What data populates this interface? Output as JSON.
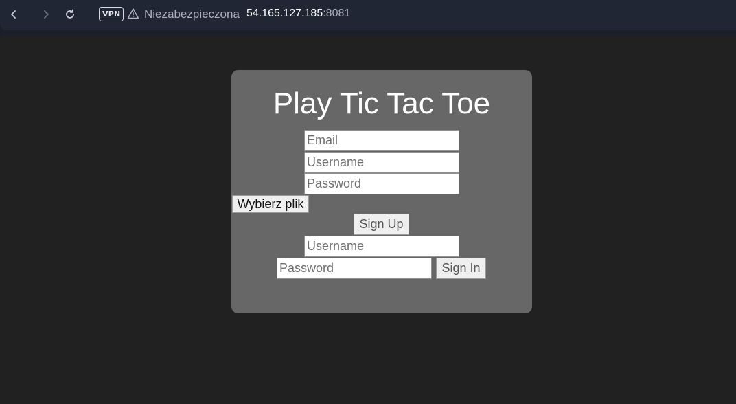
{
  "browser": {
    "vpn_label": "VPN",
    "security_label": "Niezabezpieczona",
    "url_host": "54.165.127.185",
    "url_port": ":8081"
  },
  "page": {
    "title": "Play Tic Tac Toe",
    "signup": {
      "email_placeholder": "Email",
      "username_placeholder": "Username",
      "password_placeholder": "Password",
      "file_button_label": "Wybierz plik",
      "submit_label": "Sign Up"
    },
    "signin": {
      "username_placeholder": "Username",
      "password_placeholder": "Password",
      "submit_label": "Sign In"
    }
  }
}
